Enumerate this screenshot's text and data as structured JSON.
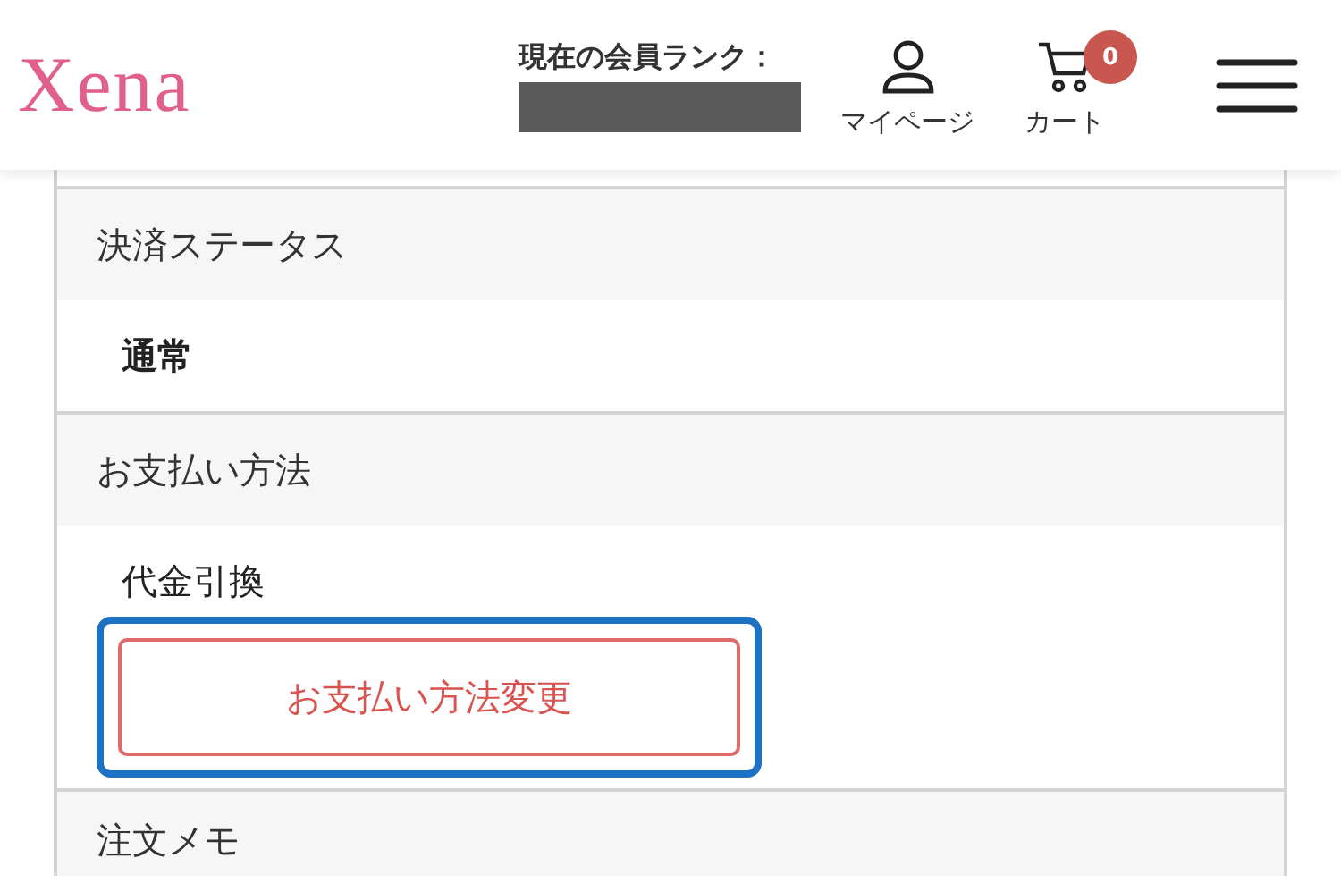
{
  "header": {
    "logo": "Xena",
    "rank_label": "現在の会員ランク：",
    "nav": [
      {
        "kind": "account",
        "label": "マイページ"
      },
      {
        "kind": "cart",
        "label": "カート",
        "badge": "0"
      }
    ]
  },
  "sections": [
    {
      "heading": "決済ステータス",
      "kind": "bold",
      "value": "通常"
    },
    {
      "heading": "お支払い方法",
      "kind": "plain",
      "value": "代金引換",
      "button": {
        "label": "お支払い方法変更",
        "focused": true
      }
    },
    {
      "heading": "注文メモ"
    }
  ]
}
